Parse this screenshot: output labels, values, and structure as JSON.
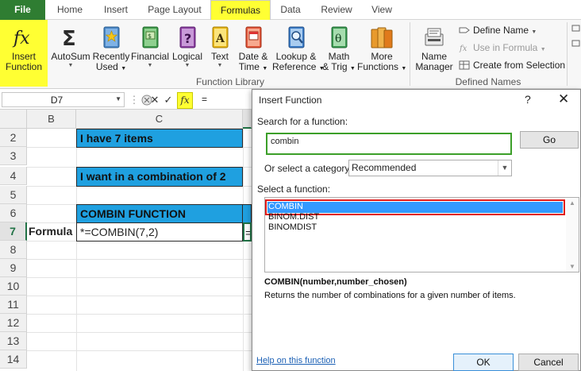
{
  "tabs": [
    "File",
    "Home",
    "Insert",
    "Page Layout",
    "Formulas",
    "Data",
    "Review",
    "View"
  ],
  "ribbon": {
    "insert_function": [
      "Insert",
      "Function"
    ],
    "buttons": [
      {
        "label": [
          "AutoSum"
        ],
        "icon": "sigma-icon"
      },
      {
        "label": [
          "Recently",
          "Used"
        ],
        "icon": "star-book-icon"
      },
      {
        "label": [
          "Financial"
        ],
        "icon": "financial-book-icon"
      },
      {
        "label": [
          "Logical"
        ],
        "icon": "question-book-icon"
      },
      {
        "label": [
          "Text"
        ],
        "icon": "text-book-icon"
      },
      {
        "label": [
          "Date &",
          "Time"
        ],
        "icon": "calendar-book-icon"
      },
      {
        "label": [
          "Lookup &",
          "Reference"
        ],
        "icon": "magnifier-book-icon"
      },
      {
        "label": [
          "Math",
          "& Trig"
        ],
        "icon": "theta-book-icon"
      },
      {
        "label": [
          "More",
          "Functions"
        ],
        "icon": "stacked-books-icon"
      },
      {
        "label": [
          "Name",
          "Manager"
        ],
        "icon": "name-manager-icon"
      }
    ],
    "group_function_library": "Function Library",
    "group_defined_names": "Defined Names",
    "define_name": "Define Name",
    "use_in_formula": "Use in Formula",
    "create_from_selection": "Create from Selection"
  },
  "formula_bar": {
    "name_box": "D7",
    "value": "="
  },
  "grid": {
    "columns": [
      "B",
      "C"
    ],
    "rows": [
      "2",
      "3",
      "4",
      "5",
      "6",
      "7",
      "8",
      "9",
      "10",
      "11",
      "12",
      "13",
      "14"
    ],
    "cells": {
      "c2": "I have 7 items",
      "c4": "I want in a combination of 2",
      "c6": "COMBIN FUNCTION",
      "b7": "Formula",
      "c7": "*=COMBIN(7,2)",
      "d7": "="
    }
  },
  "dialog": {
    "title": "Insert Function",
    "help": "?",
    "close": "✕",
    "search_label": "Search for a function:",
    "search_value": "combin",
    "go_label": "Go",
    "category_label": "Or select a category:",
    "category_value": "Recommended",
    "select_label": "Select a function:",
    "functions": [
      "COMBIN",
      "BINOM.DIST",
      "BINOMDIST"
    ],
    "signature": "COMBIN(number,number_chosen)",
    "description": "Returns the number of combinations for a given number of items.",
    "help_link": "Help on this function",
    "ok_label": "OK",
    "cancel_label": "Cancel"
  },
  "colors": {
    "file_tab": "#2f7d32",
    "highlight_yellow": "#ffff33",
    "cell_blue": "#1fa0e0",
    "selection_red": "#e01b1b",
    "search_green": "#3c9f29",
    "list_selected": "#3399ff"
  }
}
